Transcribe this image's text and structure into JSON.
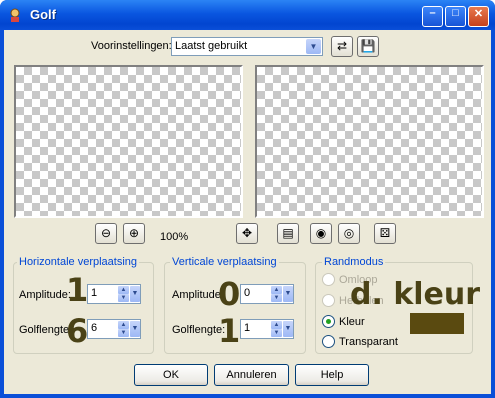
{
  "window": {
    "title": "Golf"
  },
  "presets": {
    "label": "Voorinstellingen:",
    "value": "Laatst gebruikt"
  },
  "zoom": {
    "level": "100%"
  },
  "horizontal": {
    "title": "Horizontale verplaatsing",
    "amplitude_label": "Amplitude:",
    "amplitude_value": "1",
    "wavelength_label": "Golflengte:",
    "wavelength_value": "6"
  },
  "vertical": {
    "title": "Verticale verplaatsing",
    "amplitude_label": "Amplitude:",
    "amplitude_value": "0",
    "wavelength_label": "Golflengte:",
    "wavelength_value": "1"
  },
  "edge": {
    "title": "Randmodus",
    "options": [
      "Omloop",
      "Herhalen",
      "Kleur",
      "Transparant"
    ],
    "selected": "Kleur",
    "color": "#5a4a10"
  },
  "annotations": {
    "h_amp": "1",
    "h_wave": "6",
    "v_amp": "0",
    "v_wave": "1",
    "color_note": "d. kleur"
  },
  "buttons": {
    "ok": "OK",
    "cancel": "Annuleren",
    "help": "Help"
  }
}
